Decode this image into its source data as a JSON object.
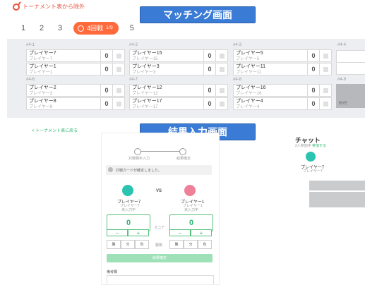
{
  "app": {
    "brand_label": "トーナメント表から除外"
  },
  "callouts": {
    "matching": "マッチング画面",
    "result": "結果入力画面"
  },
  "round_tabs": [
    {
      "label": "1"
    },
    {
      "label": "2"
    },
    {
      "label": "3"
    },
    {
      "label": "4回戦",
      "sub": "1/9",
      "active": true
    },
    {
      "label": "5"
    }
  ],
  "matches": [
    {
      "id": "#4-1",
      "p1": {
        "name": "プレイヤー7",
        "sub": "プレイヤー7",
        "score": "0"
      },
      "p2": {
        "name": "プレイヤー1",
        "sub": "プレイヤー1",
        "score": "0"
      }
    },
    {
      "id": "#4-2",
      "p1": {
        "name": "プレイヤー15",
        "sub": "プレイヤー15",
        "score": "0"
      },
      "p2": {
        "name": "プレイヤー3",
        "sub": "プレイヤー3",
        "score": "0"
      }
    },
    {
      "id": "#4-3",
      "p1": {
        "name": "プレイヤー5",
        "sub": "プレイヤー5",
        "score": "0"
      },
      "p2": {
        "name": "プレイヤー11",
        "sub": "プレイヤー11",
        "score": "0"
      }
    },
    {
      "id": "#4-6",
      "p1": {
        "name": "プレイヤー2",
        "sub": "プレイヤー2",
        "score": "0"
      },
      "p2": {
        "name": "プレイヤー8",
        "sub": "プレイヤー8",
        "score": "0"
      }
    },
    {
      "id": "#4-7",
      "p1": {
        "name": "プレイヤー12",
        "sub": "プレイヤー12",
        "score": "0"
      },
      "p2": {
        "name": "プレイヤー17",
        "sub": "プレイヤー17",
        "score": "0"
      }
    },
    {
      "id": "#4-8",
      "p1": {
        "name": "プレイヤー16",
        "sub": "プレイヤー16",
        "score": "0"
      },
      "p2": {
        "name": "プレイヤー4",
        "sub": "プレイヤー4",
        "score": "0"
      }
    }
  ],
  "bye_matches": [
    {
      "id": "#4-4"
    },
    {
      "id": "#4-9",
      "bye_label": "BYE"
    }
  ],
  "result_screen": {
    "back_link": "< トーナメント表に戻る",
    "steps": [
      "対戦相手入力",
      "結果確定"
    ],
    "notice": "対戦カードが確定しました。",
    "player_left": {
      "name": "プレイヤー7",
      "sub": "プレイヤー7",
      "note": "未入力中"
    },
    "player_right": {
      "name": "プレイヤー1",
      "sub": "プレイヤー1",
      "note": "未入力中"
    },
    "vs_label": "VS",
    "score_left": "0",
    "score_right": "0",
    "score_label": "スコア",
    "minus": "−",
    "plus": "+",
    "result_label": "勝敗",
    "wdl": [
      "勝",
      "分",
      "負"
    ],
    "confirm_button": "結果確定",
    "memo_label": "備考欄"
  },
  "chat": {
    "title": "チャット",
    "subtitle": "2人参加中",
    "subtitle_link": "参加する",
    "user_name": "プレイヤー7",
    "user_sub": "プレイヤー7"
  },
  "colors": {
    "accent_orange": "#ff6a3d",
    "accent_green": "#2bb673",
    "callout_blue": "#3a7bd5"
  }
}
